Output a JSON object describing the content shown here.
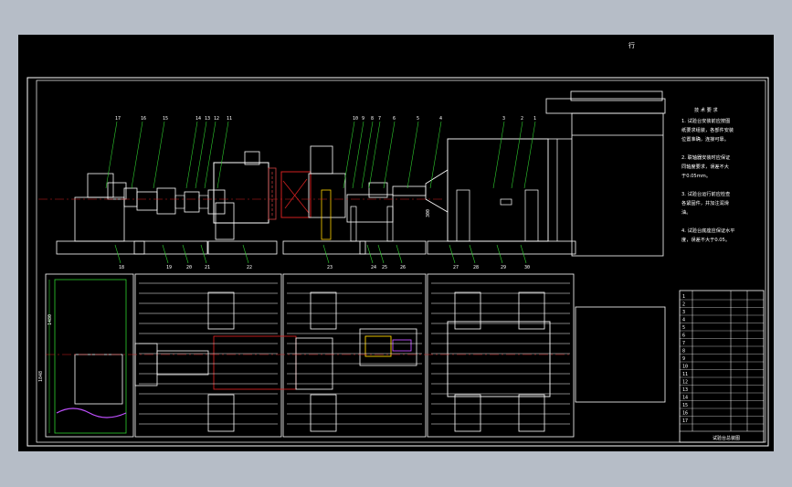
{
  "sheet_mark": "行",
  "notes": {
    "title": "技 术 要 求",
    "lines": [
      "1. 试验台安装前应按图",
      "纸要求组装，各部件安装",
      "位置准确，连接可靠。",
      "",
      "2. 联轴器安装时应保证",
      "同轴度要求，误差不大",
      "于0.05mm。",
      "",
      "3. 试验台运行前应检查",
      "各紧固件，并加注润滑",
      "油。",
      "",
      "4. 试验台底座应保证水平",
      "度，误差不大于0.05。"
    ]
  },
  "dimensions": {
    "vertical_dim": "1848",
    "left_height_dim": "1480",
    "mid_dim": "300"
  },
  "balloons": {
    "top": [
      "17",
      "16",
      "15",
      "14",
      "13",
      "12",
      "11",
      "10",
      "9",
      "8",
      "7",
      "6",
      "5",
      "4",
      "3",
      "2",
      "1"
    ],
    "bottom": [
      "18",
      "19",
      "20",
      "21",
      "22",
      "23",
      "24",
      "25",
      "26",
      "27",
      "28",
      "29",
      "30"
    ]
  },
  "title_block": {
    "rows": [
      "1",
      "2",
      "3",
      "4",
      "5",
      "6",
      "7",
      "8",
      "9",
      "10",
      "11",
      "12",
      "13",
      "14",
      "15",
      "16",
      "17"
    ],
    "footer": "试验台总装图"
  }
}
